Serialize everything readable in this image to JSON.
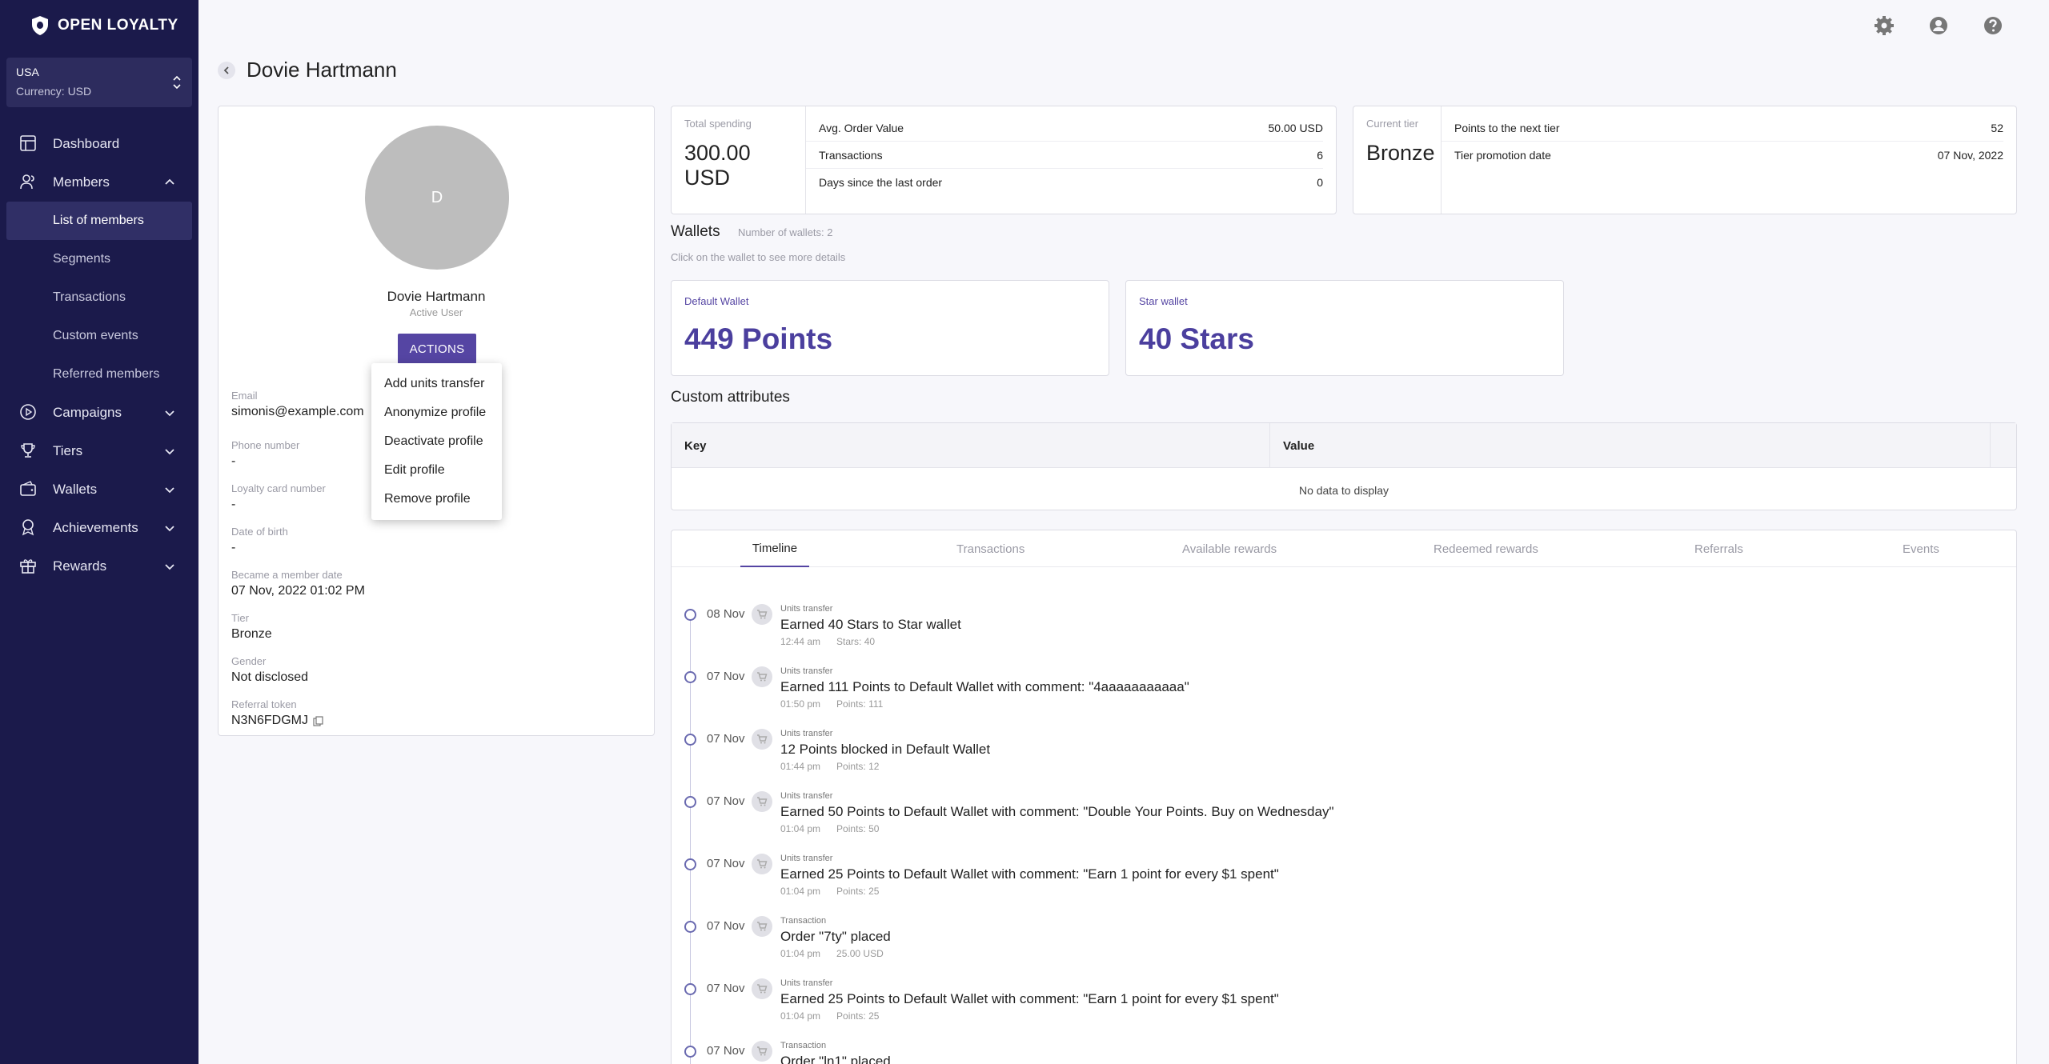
{
  "brand": {
    "name": "OPEN LOYALTY"
  },
  "region": {
    "name": "USA",
    "currency": "Currency: USD"
  },
  "nav": {
    "dashboard": "Dashboard",
    "members": "Members",
    "members_sub": [
      "List of members",
      "Segments",
      "Transactions",
      "Custom events",
      "Referred members"
    ],
    "campaigns": "Campaigns",
    "tiers": "Tiers",
    "wallets": "Wallets",
    "achievements": "Achievements",
    "rewards": "Rewards"
  },
  "page": {
    "title": "Dovie Hartmann"
  },
  "profile": {
    "avatar_letter": "D",
    "name": "Dovie Hartmann",
    "status": "Active User",
    "actions_label": "ACTIONS",
    "fields": [
      {
        "label": "Email",
        "value": "simonis@example.com"
      },
      {
        "label": "Phone number",
        "value": "-"
      },
      {
        "label": "Loyalty card number",
        "value": "-"
      },
      {
        "label": "Date of birth",
        "value": "-"
      },
      {
        "label": "Became a member date",
        "value": "07 Nov, 2022 01:02 PM"
      },
      {
        "label": "Tier",
        "value": "Bronze"
      },
      {
        "label": "Gender",
        "value": "Not disclosed"
      },
      {
        "label": "Referral token",
        "value": "N3N6FDGMJ"
      }
    ]
  },
  "actions_menu": [
    "Add units transfer",
    "Anonymize profile",
    "Deactivate profile",
    "Edit profile",
    "Remove profile"
  ],
  "spending": {
    "label": "Total spending",
    "value": "300.00 USD",
    "rows": [
      {
        "k": "Avg. Order Value",
        "v": "50.00 USD"
      },
      {
        "k": "Transactions",
        "v": "6"
      },
      {
        "k": "Days since the last order",
        "v": "0"
      }
    ]
  },
  "tier": {
    "label": "Current tier",
    "value": "Bronze",
    "rows": [
      {
        "k": "Points to the next tier",
        "v": "52"
      },
      {
        "k": "Tier promotion date",
        "v": "07 Nov, 2022"
      }
    ]
  },
  "wallets": {
    "title": "Wallets",
    "count": "Number of wallets: 2",
    "hint": "Click on the wallet to see more details",
    "items": [
      {
        "name": "Default Wallet",
        "value": "449 Points"
      },
      {
        "name": "Star wallet",
        "value": "40 Stars"
      }
    ]
  },
  "custom_attributes": {
    "title": "Custom attributes",
    "col_key": "Key",
    "col_value": "Value",
    "empty": "No data to display"
  },
  "tabs": [
    "Timeline",
    "Transactions",
    "Available rewards",
    "Redeemed rewards",
    "Referrals",
    "Events"
  ],
  "timeline": [
    {
      "date": "08 Nov",
      "type": "Units transfer",
      "title": "Earned 40 Stars to Star wallet",
      "time": "12:44 am",
      "detail": "Stars: 40"
    },
    {
      "date": "07 Nov",
      "type": "Units transfer",
      "title": "Earned 111 Points to Default Wallet with comment: \"4aaaaaaaaaaa\"",
      "time": "01:50 pm",
      "detail": "Points: 111"
    },
    {
      "date": "07 Nov",
      "type": "Units transfer",
      "title": "12 Points blocked in Default Wallet",
      "time": "01:44 pm",
      "detail": "Points: 12"
    },
    {
      "date": "07 Nov",
      "type": "Units transfer",
      "title": "Earned 50 Points to Default Wallet with comment: \"Double Your Points. Buy on Wednesday\"",
      "time": "01:04 pm",
      "detail": "Points: 50"
    },
    {
      "date": "07 Nov",
      "type": "Units transfer",
      "title": "Earned 25 Points to Default Wallet with comment: \"Earn 1 point for every $1 spent\"",
      "time": "01:04 pm",
      "detail": "Points: 25"
    },
    {
      "date": "07 Nov",
      "type": "Transaction",
      "title": "Order \"7ty\" placed",
      "time": "01:04 pm",
      "detail": "25.00 USD"
    },
    {
      "date": "07 Nov",
      "type": "Units transfer",
      "title": "Earned 25 Points to Default Wallet with comment: \"Earn 1 point for every $1 spent\"",
      "time": "01:04 pm",
      "detail": "Points: 25"
    },
    {
      "date": "07 Nov",
      "type": "Transaction",
      "title": "Order \"ln1\" placed",
      "time": "",
      "detail": ""
    }
  ],
  "colors": {
    "sidebar": "#1b1a4b",
    "accent": "#5545a3",
    "wallet_value": "#4b3f9e"
  }
}
